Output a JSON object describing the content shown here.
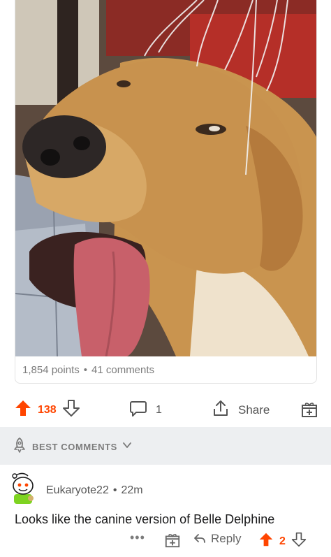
{
  "post": {
    "image_alt": "Close-up photo of a yellow dog with tongue out and a wire head massager on its head",
    "points": "1,854 points",
    "separator": "•",
    "comments_count": "41 comments"
  },
  "actions": {
    "upvote_count": "138",
    "comment_count": "1",
    "share_label": "Share"
  },
  "sort": {
    "label": "BEST COMMENTS"
  },
  "comment": {
    "author": "Eukaryote22",
    "separator": "•",
    "time": "22m",
    "body": "Looks like the canine version of Belle Delphine",
    "more": "•••",
    "reply_label": "Reply",
    "score": "2"
  },
  "colors": {
    "accent": "#ff4500",
    "sort_bar_bg": "#edeff1",
    "muted_text": "#7c7c7c"
  }
}
